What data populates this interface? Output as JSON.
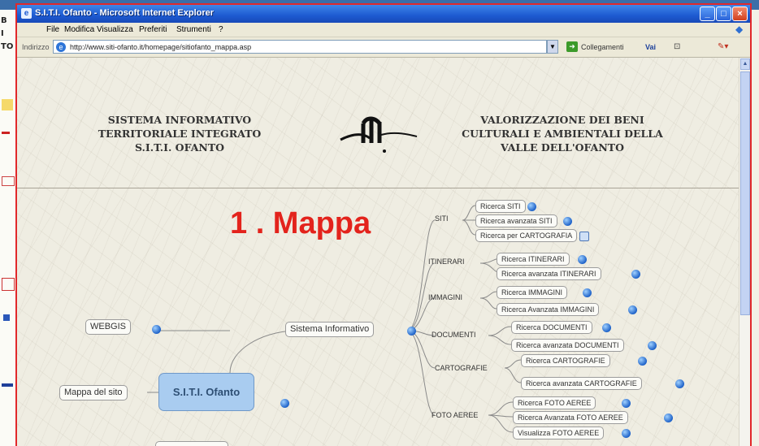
{
  "background_window": {
    "left_edge_chars": [
      "B",
      "I",
      "TO",
      "",
      "",
      "",
      "",
      "",
      "",
      "",
      "",
      "",
      "",
      "",
      "",
      ""
    ]
  },
  "browser": {
    "title": "S.I.T.I. Ofanto - Microsoft Internet Explorer",
    "menu": [
      "File",
      "Modifica",
      "Visualizza",
      "Preferiti",
      "Strumenti",
      "?"
    ],
    "address_label": "Indirizzo",
    "url": "http://www.siti-ofanto.it/homepage/sitiofanto_mappa.asp",
    "collegamenti_label": "Collegamenti",
    "vai_label": "Vai"
  },
  "page": {
    "header_left": [
      "SISTEMA INFORMATIVO",
      "TERRITORIALE INTEGRATO",
      "S.I.T.I. OFANTO"
    ],
    "header_right": [
      "VALORIZZAZIONE DEI BENI",
      "CULTURALI E AMBIENTALI DELLA",
      "VALLE DELL'OFANTO"
    ],
    "slide_title": "1 . Mappa",
    "centre_node": "S.I.T.I. Ofanto",
    "left_nodes": {
      "webgis": "WEBGIS",
      "mappa_sito": "Mappa del sito"
    },
    "sistema_node": "Sistema Informativo",
    "categories": [
      {
        "label": "SITI",
        "items": [
          "Ricerca SITI",
          "Ricerca avanzata SITI",
          "Ricerca per CARTOGRAFIA"
        ]
      },
      {
        "label": "ITINERARI",
        "items": [
          "Ricerca ITINERARI",
          "Ricerca avanzata ITINERARI"
        ]
      },
      {
        "label": "IMMAGINI",
        "items": [
          "Ricerca IMMAGINI",
          "Ricerca Avanzata IMMAGINI"
        ]
      },
      {
        "label": "DOCUMENTI",
        "items": [
          "Ricerca DOCUMENTI",
          "Ricerca avanzata DOCUMENTI"
        ]
      },
      {
        "label": "CARTOGRAFIE",
        "items": [
          "Ricerca CARTOGRAFIE",
          "Ricerca avanzata CARTOGRAFIE"
        ]
      },
      {
        "label": "FOTO AEREE",
        "items": [
          "Ricerca FOTO AEREE",
          "Ricerca Avanzata FOTO AEREE",
          "Visualizza FOTO AEREE"
        ]
      }
    ]
  }
}
